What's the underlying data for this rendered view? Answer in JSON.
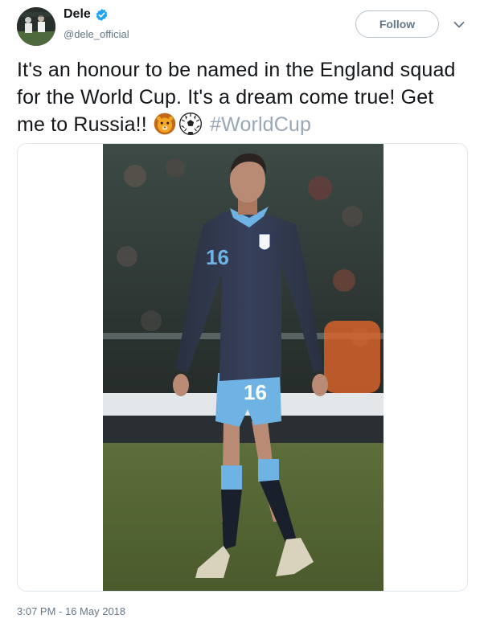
{
  "user": {
    "display_name": "Dele",
    "handle": "@dele_official",
    "verified": true
  },
  "actions": {
    "follow_label": "Follow",
    "menu_icon": "chevron-down-icon"
  },
  "tweet": {
    "text": "It's an honour to be named in the England squad for the World Cup. It's a dream come true! Get me to Russia!! ",
    "emojis": [
      "lion-face-emoji",
      "soccer-ball-emoji"
    ],
    "hashtag": "#WorldCup",
    "timestamp": "3:07 PM - 16 May 2018"
  },
  "media": {
    "description": "photo",
    "shirt_number": "16"
  },
  "colors": {
    "verified_blue": "#1da1f2",
    "hashtag": "#98a7b6",
    "secondary_text": "#657786",
    "border": "#e1e8ed"
  }
}
